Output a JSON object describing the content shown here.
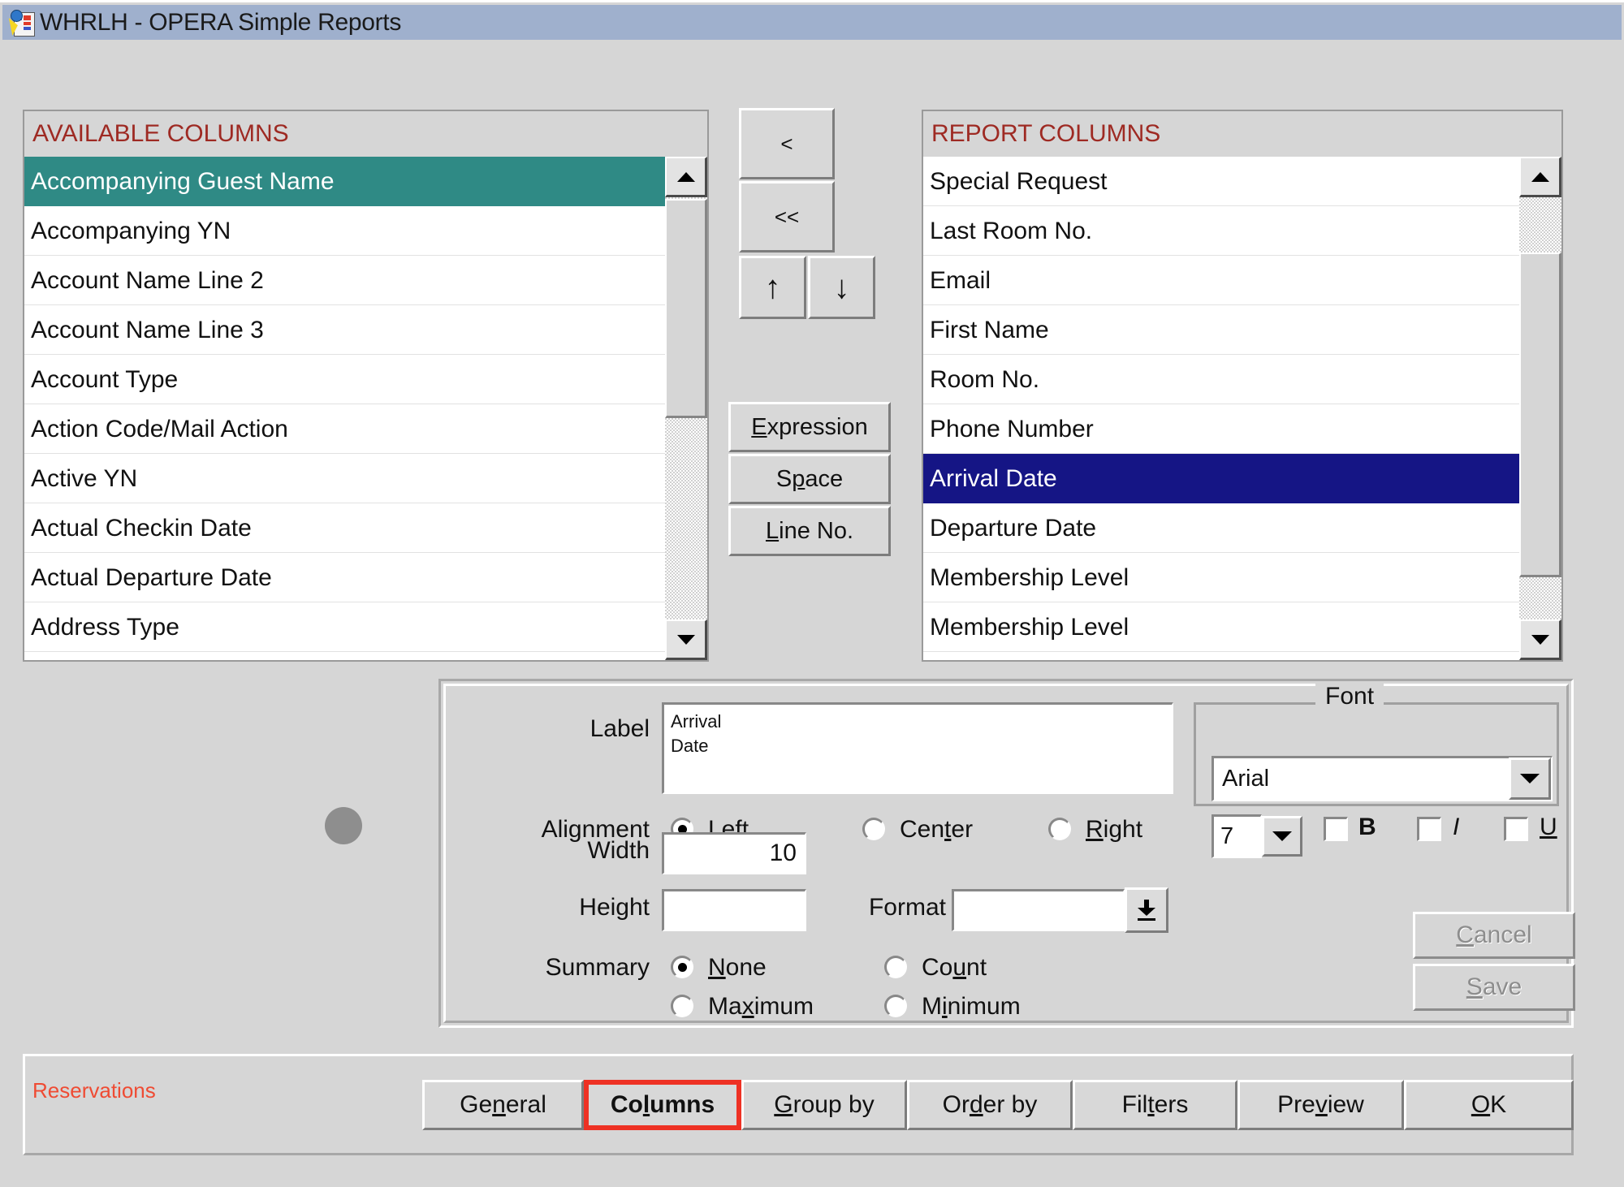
{
  "window": {
    "title": "WHRLH - OPERA Simple Reports",
    "icon": "report-app-icon"
  },
  "available_columns": {
    "header": "AVAILABLE COLUMNS",
    "items": [
      {
        "label": "Accompanying Guest Name",
        "selected": true
      },
      {
        "label": "Accompanying YN",
        "selected": false
      },
      {
        "label": "Account Name Line 2",
        "selected": false
      },
      {
        "label": "Account Name Line 3",
        "selected": false
      },
      {
        "label": "Account Type",
        "selected": false
      },
      {
        "label": "Action Code/Mail Action",
        "selected": false
      },
      {
        "label": "Active YN",
        "selected": false
      },
      {
        "label": "Actual Checkin Date",
        "selected": false
      },
      {
        "label": "Actual Departure Date",
        "selected": false
      },
      {
        "label": "Address Type",
        "selected": false
      }
    ]
  },
  "report_columns": {
    "header": "REPORT COLUMNS",
    "items": [
      {
        "label": "Special Request",
        "selected": false
      },
      {
        "label": "Last Room No.",
        "selected": false
      },
      {
        "label": "Email",
        "selected": false
      },
      {
        "label": "First Name",
        "selected": false
      },
      {
        "label": "Room No.",
        "selected": false
      },
      {
        "label": "Phone Number",
        "selected": false
      },
      {
        "label": "Arrival Date",
        "selected": true
      },
      {
        "label": "Departure Date",
        "selected": false
      },
      {
        "label": "Membership Level",
        "selected": false
      },
      {
        "label": "Membership Level",
        "selected": false
      }
    ]
  },
  "transfer_buttons": {
    "move_one": "<",
    "move_all": "<<",
    "move_up": "↑",
    "move_down": "↓"
  },
  "action_buttons": {
    "expression": "Expression",
    "space": "Space",
    "line_no": "Line No."
  },
  "properties": {
    "label_field": {
      "caption": "Label",
      "value": "Arrival\nDate"
    },
    "alignment": {
      "caption": "Alignment",
      "options": [
        "Left",
        "Center",
        "Right"
      ],
      "selected": "Left"
    },
    "width": {
      "caption": "Width",
      "value": "10"
    },
    "height": {
      "caption": "Height",
      "value": ""
    },
    "format": {
      "caption": "Format",
      "value": ""
    },
    "summary": {
      "caption": "Summary",
      "options": [
        "None",
        "Count",
        "Maximum",
        "Minimum"
      ],
      "selected": "None"
    }
  },
  "font": {
    "title": "Font",
    "name": "Arial",
    "size": "7",
    "bold": {
      "label": "B",
      "checked": false
    },
    "italic": {
      "label": "I",
      "checked": false
    },
    "underline": {
      "label": "U",
      "checked": false
    }
  },
  "form_buttons": {
    "cancel": "Cancel",
    "save": "Save"
  },
  "bottom": {
    "module": "Reservations",
    "tabs": [
      {
        "label": "General",
        "active": false
      },
      {
        "label": "Columns",
        "active": true
      },
      {
        "label": "Group by",
        "active": false
      },
      {
        "label": "Order by",
        "active": false
      },
      {
        "label": "Filters",
        "active": false
      },
      {
        "label": "Preview",
        "active": false
      },
      {
        "label": "OK",
        "active": false
      }
    ]
  },
  "colors": {
    "titlebar": "#9fb0cd",
    "face": "#d6d6d6",
    "header_text": "#9e2a23",
    "available_selection": "#2f8a85",
    "report_selection": "#151585",
    "module_label": "#ef4b33",
    "active_tab_border": "#ee3124"
  }
}
